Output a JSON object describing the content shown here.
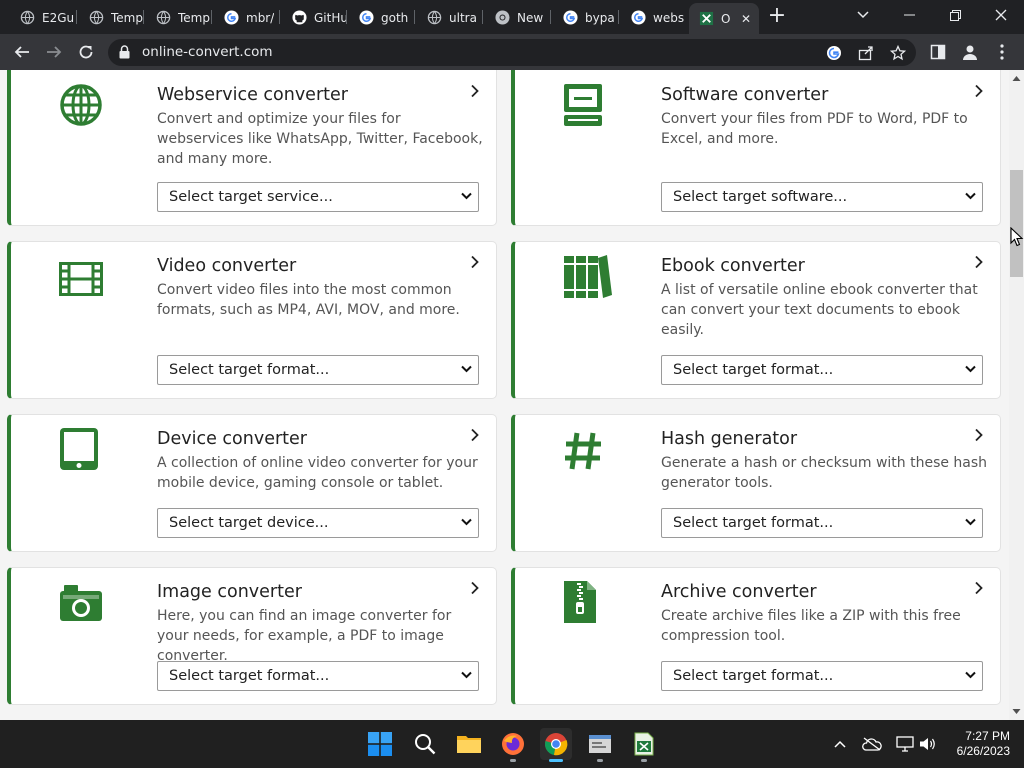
{
  "browser": {
    "tabs": [
      {
        "title": "E2Gu",
        "icon": "globe-icon"
      },
      {
        "title": "Temp",
        "icon": "globe-icon"
      },
      {
        "title": "Temp",
        "icon": "globe-icon"
      },
      {
        "title": "mbr/",
        "icon": "google-icon"
      },
      {
        "title": "GitHu",
        "icon": "github-icon"
      },
      {
        "title": "goth",
        "icon": "google-icon"
      },
      {
        "title": "ultra",
        "icon": "globe-icon"
      },
      {
        "title": "New",
        "icon": "chrome-icon"
      },
      {
        "title": "bypa",
        "icon": "google-icon"
      },
      {
        "title": "webs",
        "icon": "google-icon"
      },
      {
        "title": "O",
        "icon": "excel-favicon-icon",
        "active": true
      }
    ],
    "url": "online-convert.com"
  },
  "cards": [
    {
      "title": "Webservice converter",
      "description": "Convert and optimize your files for webservices like WhatsApp, Twitter, Facebook, and many more.",
      "select": "Select target service...",
      "icon": "globe-icon"
    },
    {
      "title": "Software converter",
      "description": "Convert your files from PDF to Word, PDF to Excel, and more.",
      "select": "Select target software...",
      "icon": "computer-icon"
    },
    {
      "title": "Video converter",
      "description": "Convert video files into the most common formats, such as MP4, AVI, MOV, and more.",
      "select": "Select target format...",
      "icon": "film-icon"
    },
    {
      "title": "Ebook converter",
      "description": "A list of versatile online ebook converter that can convert your text documents to ebook easily.",
      "select": "Select target format...",
      "icon": "books-icon"
    },
    {
      "title": "Device converter",
      "description": "A collection of online video converter for your mobile device, gaming console or tablet.",
      "select": "Select target device...",
      "icon": "tablet-icon"
    },
    {
      "title": "Hash generator",
      "description": "Generate a hash or checksum with these hash generator tools.",
      "select": "Select target format...",
      "icon": "hash-icon"
    },
    {
      "title": "Image converter",
      "description": "Here, you can find an image converter for your needs, for example, a PDF to image converter.",
      "select": "Select target format...",
      "icon": "camera-icon"
    },
    {
      "title": "Archive converter",
      "description": "Create archive files like a ZIP with this free compression tool.",
      "select": "Select target format...",
      "icon": "zip-file-icon"
    }
  ],
  "colors": {
    "accent": "#2e7d32",
    "taskbar_active": "#4cc2ff"
  },
  "taskbar": {
    "apps": [
      "windows-start-icon",
      "search-icon",
      "file-explorer-icon",
      "firefox-icon",
      "chrome-icon",
      "app-window-icon",
      "excel-file-icon"
    ],
    "time": "7:27 PM",
    "date": "6/26/2023"
  }
}
